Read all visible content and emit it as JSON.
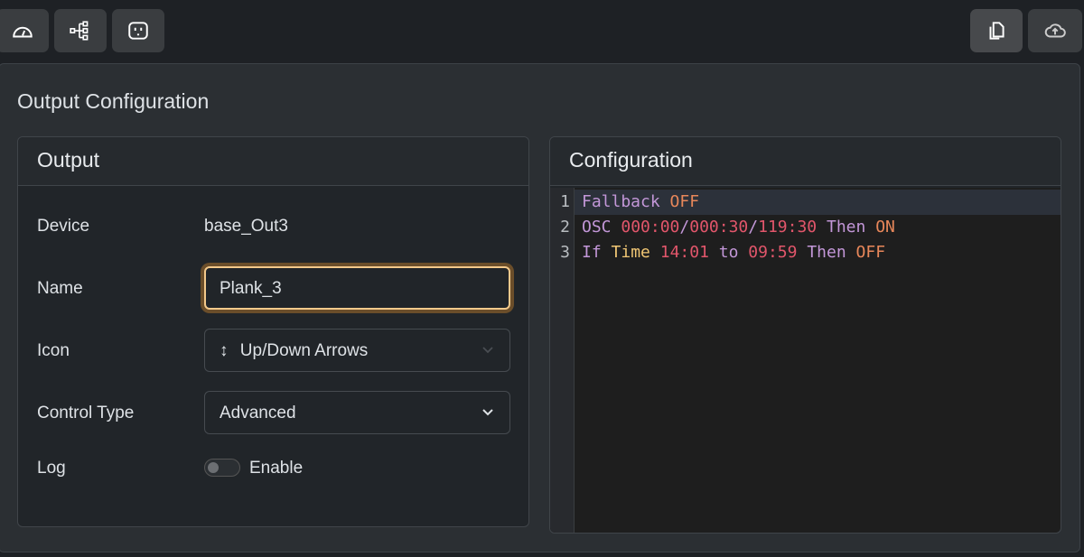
{
  "toolbar": {
    "left": [
      {
        "icon": "dashboard-gauge-icon"
      },
      {
        "icon": "diagram-tree-icon"
      },
      {
        "icon": "outlet-icon"
      }
    ],
    "right": [
      {
        "icon": "copy-icon"
      },
      {
        "icon": "cloud-upload-icon"
      }
    ]
  },
  "page_title": "Output Configuration",
  "output": {
    "header": "Output",
    "device_label": "Device",
    "device_value": "base_Out3",
    "name_label": "Name",
    "name_value": "Plank_3",
    "icon_label": "Icon",
    "icon_value": "Up/Down Arrows",
    "icon_glyph": "↕",
    "control_type_label": "Control Type",
    "control_type_value": "Advanced",
    "log_label": "Log",
    "log_toggle_label": "Enable",
    "log_enabled": false
  },
  "configuration": {
    "header": "Configuration",
    "lines": [
      {
        "n": "1",
        "tokens": [
          "Fallback",
          " ",
          "OFF"
        ]
      },
      {
        "n": "2",
        "tokens": [
          "OSC",
          " ",
          "000:00",
          "/",
          "000:30",
          "/",
          "119:30",
          " ",
          "Then",
          " ",
          "ON"
        ]
      },
      {
        "n": "3",
        "tokens": [
          "If",
          " ",
          "Time",
          " ",
          "14:01",
          " ",
          "to",
          " ",
          "09:59",
          " ",
          "Then",
          " ",
          "OFF"
        ]
      }
    ]
  },
  "colors": {
    "keyword": "#c397d8",
    "state": "#e8875a",
    "number": "#e2566b",
    "field": "#f0c674",
    "focus": "#f3c98b"
  }
}
